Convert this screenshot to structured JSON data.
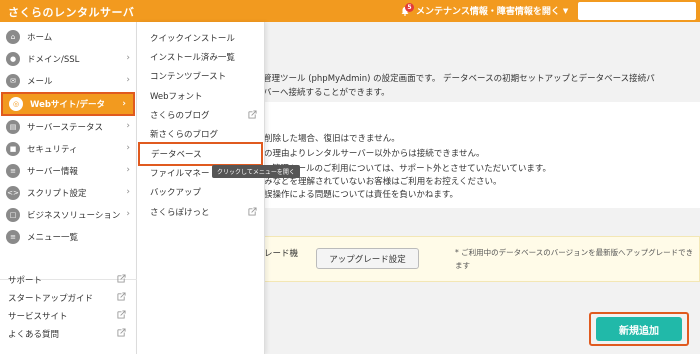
{
  "header": {
    "brand": "さくらのレンタルサーバ",
    "notice_count": "5",
    "notice_label": "メンテナンス情報・障害情報を開く",
    "colors": {
      "primary": "#f29a1f",
      "highlight": "#e05a1f",
      "accent": "#21b9a9"
    }
  },
  "sidebar": {
    "items": [
      {
        "label": "ホーム",
        "icon": "home-icon"
      },
      {
        "label": "ドメイン/SSL",
        "icon": "globe-icon"
      },
      {
        "label": "メール",
        "icon": "mail-icon"
      },
      {
        "label": "Webサイト/データ",
        "icon": "web-icon"
      },
      {
        "label": "サーバーステータス",
        "icon": "chart-icon"
      },
      {
        "label": "セキュリティ",
        "icon": "lock-icon"
      },
      {
        "label": "サーバー情報",
        "icon": "server-icon"
      },
      {
        "label": "スクリプト設定",
        "icon": "code-icon"
      },
      {
        "label": "ビジネスソリューション",
        "icon": "briefcase-icon"
      },
      {
        "label": "メニュー一覧",
        "icon": "list-icon"
      }
    ],
    "links": [
      {
        "label": "サポート"
      },
      {
        "label": "スタートアップガイド"
      },
      {
        "label": "サービスサイト"
      },
      {
        "label": "よくある質問"
      }
    ]
  },
  "submenu": {
    "items": [
      {
        "label": "クイックインストール"
      },
      {
        "label": "インストール済み一覧"
      },
      {
        "label": "コンテンツブースト"
      },
      {
        "label": "Webフォント"
      },
      {
        "label": "さくらのブログ"
      },
      {
        "label": "新さくらのブログ"
      },
      {
        "label": "データベース"
      },
      {
        "label": "ファイルマネー"
      },
      {
        "label": "バックアップ"
      },
      {
        "label": "さくらぽけっと"
      }
    ],
    "tooltip": "クリックしてメニューを開く"
  },
  "main": {
    "intro_line1": "管理ツール (phpMyAdmin) の設定画面です。 データベースの初期セットアップとデータベース接続パ",
    "intro_line2": "バーへ接続することができます。",
    "warnings": [
      "削除した場合、復旧はできません。",
      "の理由よりレンタルサーバー以外からは接続できません。",
      "管理ツールのご利用については、サポート外とさせていただいています。",
      "みなどを理解されていないお客様はご利用をお控えください。",
      "誤操作による問題については責任を負いかねます。"
    ],
    "upgrade_label_part": "レード機",
    "upgrade_button": "アップグレード設定",
    "upgrade_note": "ご利用中のデータベースのバージョンを最新版へアップグレードできます",
    "add_button": "新規追加"
  }
}
